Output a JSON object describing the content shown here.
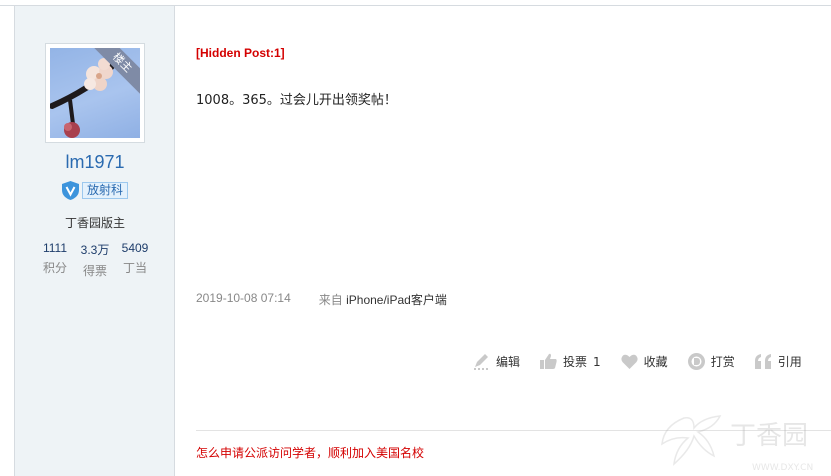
{
  "author": {
    "avatar_ribbon": "楼主",
    "username": "lm1971",
    "badge": "放射科",
    "rank": "丁香园版主",
    "stats": [
      {
        "value": "1111",
        "label": "积分"
      },
      {
        "value": "3.3万",
        "label": "得票"
      },
      {
        "value": "5409",
        "label": "丁当"
      }
    ]
  },
  "post": {
    "hidden_label": "[Hidden Post:1]",
    "content": "1008。365。过会儿开出领奖帖！",
    "timestamp": "2019-10-08 07:14",
    "source_prefix": "来自",
    "source": "iPhone/iPad客户端"
  },
  "actions": {
    "edit": "编辑",
    "vote": "投票",
    "vote_count": "1",
    "favorite": "收藏",
    "reward": "打赏",
    "quote": "引用"
  },
  "promo_link": "怎么申请公派访问学者，顺利加入美国名校",
  "watermark": {
    "name": "丁香园",
    "url": "WWW.DXY.CN"
  },
  "colors": {
    "sidebar_bg": "#eef3f6",
    "username": "#2a6ab0",
    "hidden_label": "#d40000",
    "promo": "#d40000"
  }
}
